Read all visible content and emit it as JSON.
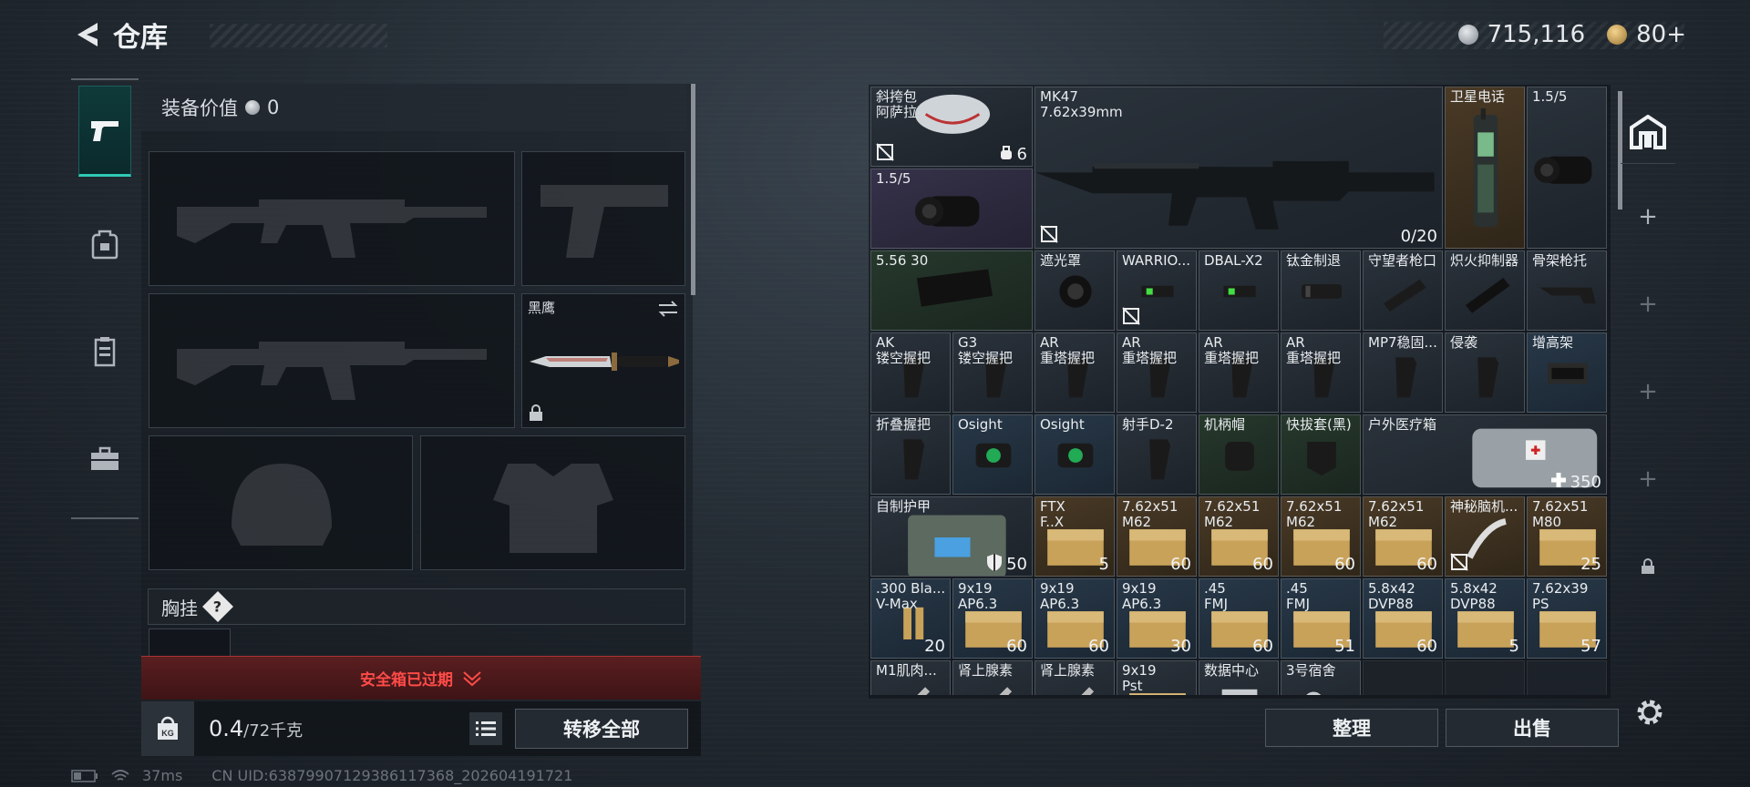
{
  "header": {
    "title": "仓库",
    "currency": "715,116",
    "medals": "80+"
  },
  "equipment": {
    "value_label": "装备价值",
    "value": "0",
    "melee_name": "黑鹰",
    "chest_label": "胸挂",
    "chest_help": "?",
    "safe_box_status": "安全箱已过期",
    "weight_value": "0.4",
    "weight_max": "/72千克",
    "weight_icon_text": "KG",
    "transfer_all": "转移全部"
  },
  "status_bar": {
    "ping": "37ms",
    "uid": "CN UID:638799071293861173​68_202604191721"
  },
  "stash": {
    "sort": "整理",
    "sell": "出售",
    "items": [
      {
        "r": 0,
        "c": 0,
        "w": 2,
        "h": 1,
        "name": "斜挎包\n阿萨拉",
        "count": "6",
        "color": "def",
        "icon": "bag-icon",
        "badge": "no-insure"
      },
      {
        "r": 0,
        "c": 2,
        "w": 5,
        "h": 2,
        "name": "MK47\n7.62x39mm",
        "count": "0/20",
        "color": "def",
        "icon": "rifle-icon",
        "badge": "no-insure"
      },
      {
        "r": 0,
        "c": 7,
        "w": 1,
        "h": 2,
        "name": "卫星电话",
        "count": "",
        "color": "gold",
        "icon": "phone-icon"
      },
      {
        "r": 0,
        "c": 8,
        "w": 1,
        "h": 2,
        "name": "1.5/5",
        "count": "",
        "color": "def",
        "icon": "scope-icon"
      },
      {
        "r": 1,
        "c": 0,
        "w": 2,
        "h": 1,
        "name": "1.5/5",
        "count": "",
        "color": "purple",
        "icon": "scope-icon"
      },
      {
        "r": 2,
        "c": 0,
        "w": 2,
        "h": 1,
        "name": "5.56 30",
        "count": "",
        "color": "green",
        "icon": "magazine-icon"
      },
      {
        "r": 2,
        "c": 2,
        "w": 1,
        "h": 1,
        "name": "遮光罩",
        "count": "",
        "color": "def",
        "icon": "hood-icon"
      },
      {
        "r": 2,
        "c": 3,
        "w": 1,
        "h": 1,
        "name": "WARRIO...",
        "count": "",
        "color": "def",
        "icon": "laser-icon",
        "badge": "no-insure"
      },
      {
        "r": 2,
        "c": 4,
        "w": 1,
        "h": 1,
        "name": "DBAL-X2",
        "count": "",
        "color": "def",
        "icon": "laser-icon"
      },
      {
        "r": 2,
        "c": 5,
        "w": 1,
        "h": 1,
        "name": "钛金制退",
        "count": "",
        "color": "def",
        "icon": "brake-icon"
      },
      {
        "r": 2,
        "c": 6,
        "w": 1,
        "h": 1,
        "name": "守望者枪口",
        "count": "",
        "color": "def",
        "icon": "muzzle-icon"
      },
      {
        "r": 2,
        "c": 7,
        "w": 1,
        "h": 1,
        "name": "炽火抑制器",
        "count": "",
        "color": "def",
        "icon": "suppressor-icon"
      },
      {
        "r": 2,
        "c": 8,
        "w": 1,
        "h": 1,
        "name": "骨架枪托",
        "count": "",
        "color": "def",
        "icon": "stock-icon"
      },
      {
        "r": 3,
        "c": 0,
        "w": 1,
        "h": 1,
        "name": "AK\n镂空握把",
        "count": "",
        "color": "def",
        "icon": "grip-icon"
      },
      {
        "r": 3,
        "c": 1,
        "w": 1,
        "h": 1,
        "name": "G3\n镂空握把",
        "count": "",
        "color": "def",
        "icon": "grip-icon"
      },
      {
        "r": 3,
        "c": 2,
        "w": 1,
        "h": 1,
        "name": "AR\n重塔握把",
        "count": "",
        "color": "def",
        "icon": "grip-icon"
      },
      {
        "r": 3,
        "c": 3,
        "w": 1,
        "h": 1,
        "name": "AR\n重塔握把",
        "count": "",
        "color": "def",
        "icon": "grip-icon"
      },
      {
        "r": 3,
        "c": 4,
        "w": 1,
        "h": 1,
        "name": "AR\n重塔握把",
        "count": "",
        "color": "def",
        "icon": "grip-icon"
      },
      {
        "r": 3,
        "c": 5,
        "w": 1,
        "h": 1,
        "name": "AR\n重塔握把",
        "count": "",
        "color": "def",
        "icon": "grip-icon"
      },
      {
        "r": 3,
        "c": 6,
        "w": 1,
        "h": 1,
        "name": "MP7稳固...",
        "count": "",
        "color": "def",
        "icon": "grip-icon"
      },
      {
        "r": 3,
        "c": 7,
        "w": 1,
        "h": 1,
        "name": "侵袭",
        "count": "",
        "color": "def",
        "icon": "grip-icon"
      },
      {
        "r": 3,
        "c": 8,
        "w": 1,
        "h": 1,
        "name": "增高架",
        "count": "",
        "color": "blue",
        "icon": "riser-icon"
      },
      {
        "r": 4,
        "c": 0,
        "w": 1,
        "h": 1,
        "name": "折叠握把",
        "count": "",
        "color": "def",
        "icon": "grip-icon"
      },
      {
        "r": 4,
        "c": 1,
        "w": 1,
        "h": 1,
        "name": "Osight",
        "count": "",
        "color": "blue",
        "icon": "sight-icon"
      },
      {
        "r": 4,
        "c": 2,
        "w": 1,
        "h": 1,
        "name": "Osight",
        "count": "",
        "color": "blue",
        "icon": "sight-icon"
      },
      {
        "r": 4,
        "c": 3,
        "w": 1,
        "h": 1,
        "name": "射手D-2",
        "count": "",
        "color": "def",
        "icon": "grip-icon"
      },
      {
        "r": 4,
        "c": 4,
        "w": 1,
        "h": 1,
        "name": "机柄帽",
        "count": "",
        "color": "green",
        "icon": "cap-icon"
      },
      {
        "r": 4,
        "c": 5,
        "w": 1,
        "h": 1,
        "name": "快拔套(黑)",
        "count": "",
        "color": "green",
        "icon": "holster-icon"
      },
      {
        "r": 4,
        "c": 6,
        "w": 3,
        "h": 1,
        "name": "户外医疗箱",
        "count": "350",
        "color": "def",
        "icon": "medkit-icon",
        "badge": "plus"
      },
      {
        "r": 5,
        "c": 0,
        "w": 2,
        "h": 1,
        "name": "自制护甲",
        "count": "50",
        "color": "def",
        "icon": "armor-icon",
        "badge": "shield"
      },
      {
        "r": 5,
        "c": 2,
        "w": 1,
        "h": 1,
        "name": "FTX\nF..X",
        "count": "5",
        "color": "gold",
        "icon": "ammo-box-icon"
      },
      {
        "r": 5,
        "c": 3,
        "w": 1,
        "h": 1,
        "name": "7.62x51\nM62",
        "count": "60",
        "color": "gold",
        "icon": "ammo-box-icon"
      },
      {
        "r": 5,
        "c": 4,
        "w": 1,
        "h": 1,
        "name": "7.62x51\nM62",
        "count": "60",
        "color": "gold",
        "icon": "ammo-box-icon"
      },
      {
        "r": 5,
        "c": 5,
        "w": 1,
        "h": 1,
        "name": "7.62x51\nM62",
        "count": "60",
        "color": "gold",
        "icon": "ammo-box-icon"
      },
      {
        "r": 5,
        "c": 6,
        "w": 1,
        "h": 1,
        "name": "7.62x51\nM62",
        "count": "60",
        "color": "gold",
        "icon": "ammo-box-icon"
      },
      {
        "r": 5,
        "c": 7,
        "w": 1,
        "h": 1,
        "name": "神秘脑机...",
        "count": "",
        "color": "gold",
        "icon": "implant-icon",
        "badge": "no-insure"
      },
      {
        "r": 5,
        "c": 8,
        "w": 1,
        "h": 1,
        "name": "7.62x51\nM80",
        "count": "25",
        "color": "gold",
        "icon": "ammo-box-icon"
      },
      {
        "r": 6,
        "c": 0,
        "w": 1,
        "h": 1,
        "name": ".300 Bla...\nV-Max",
        "count": "20",
        "color": "blue",
        "icon": "ammo-icon"
      },
      {
        "r": 6,
        "c": 1,
        "w": 1,
        "h": 1,
        "name": "9x19\nAP6.3",
        "count": "60",
        "color": "blue",
        "icon": "ammo-box-icon"
      },
      {
        "r": 6,
        "c": 2,
        "w": 1,
        "h": 1,
        "name": "9x19\nAP6.3",
        "count": "60",
        "color": "blue",
        "icon": "ammo-box-icon"
      },
      {
        "r": 6,
        "c": 3,
        "w": 1,
        "h": 1,
        "name": "9x19\nAP6.3",
        "count": "30",
        "color": "blue",
        "icon": "ammo-box-icon"
      },
      {
        "r": 6,
        "c": 4,
        "w": 1,
        "h": 1,
        "name": ".45\nFMJ",
        "count": "60",
        "color": "blue",
        "icon": "ammo-box-icon"
      },
      {
        "r": 6,
        "c": 5,
        "w": 1,
        "h": 1,
        "name": ".45\nFMJ",
        "count": "51",
        "color": "blue",
        "icon": "ammo-box-icon"
      },
      {
        "r": 6,
        "c": 6,
        "w": 1,
        "h": 1,
        "name": "5.8x42\nDVP88",
        "count": "60",
        "color": "blue",
        "icon": "ammo-box-icon"
      },
      {
        "r": 6,
        "c": 7,
        "w": 1,
        "h": 1,
        "name": "5.8x42\nDVP88",
        "count": "5",
        "color": "blue",
        "icon": "ammo-box-icon"
      },
      {
        "r": 6,
        "c": 8,
        "w": 1,
        "h": 1,
        "name": "7.62x39\nPS",
        "count": "57",
        "color": "blue",
        "icon": "ammo-box-icon"
      },
      {
        "r": 7,
        "c": 0,
        "w": 1,
        "h": 1,
        "name": "M1肌肉...",
        "count": "",
        "color": "def",
        "icon": "syringe-icon"
      },
      {
        "r": 7,
        "c": 1,
        "w": 1,
        "h": 1,
        "name": "肾上腺素",
        "count": "",
        "color": "def",
        "icon": "syringe-icon"
      },
      {
        "r": 7,
        "c": 2,
        "w": 1,
        "h": 1,
        "name": "肾上腺素",
        "count": "",
        "color": "def",
        "icon": "syringe-icon"
      },
      {
        "r": 7,
        "c": 3,
        "w": 1,
        "h": 1,
        "name": "9x19\nPst",
        "count": "",
        "color": "def",
        "icon": "ammo-box-icon"
      },
      {
        "r": 7,
        "c": 4,
        "w": 1,
        "h": 1,
        "name": "数据中心",
        "count": "",
        "color": "def",
        "icon": "card-icon"
      },
      {
        "r": 7,
        "c": 5,
        "w": 1,
        "h": 1,
        "name": "3号宿舍",
        "count": "",
        "color": "def",
        "icon": "key-icon"
      }
    ]
  },
  "colors": {
    "accent": "#2fc9b5",
    "alert": "#ff4b48",
    "def": "#232a31",
    "blue": "#233342",
    "purple": "#302c42",
    "green": "#223227",
    "gold": "#433522"
  }
}
